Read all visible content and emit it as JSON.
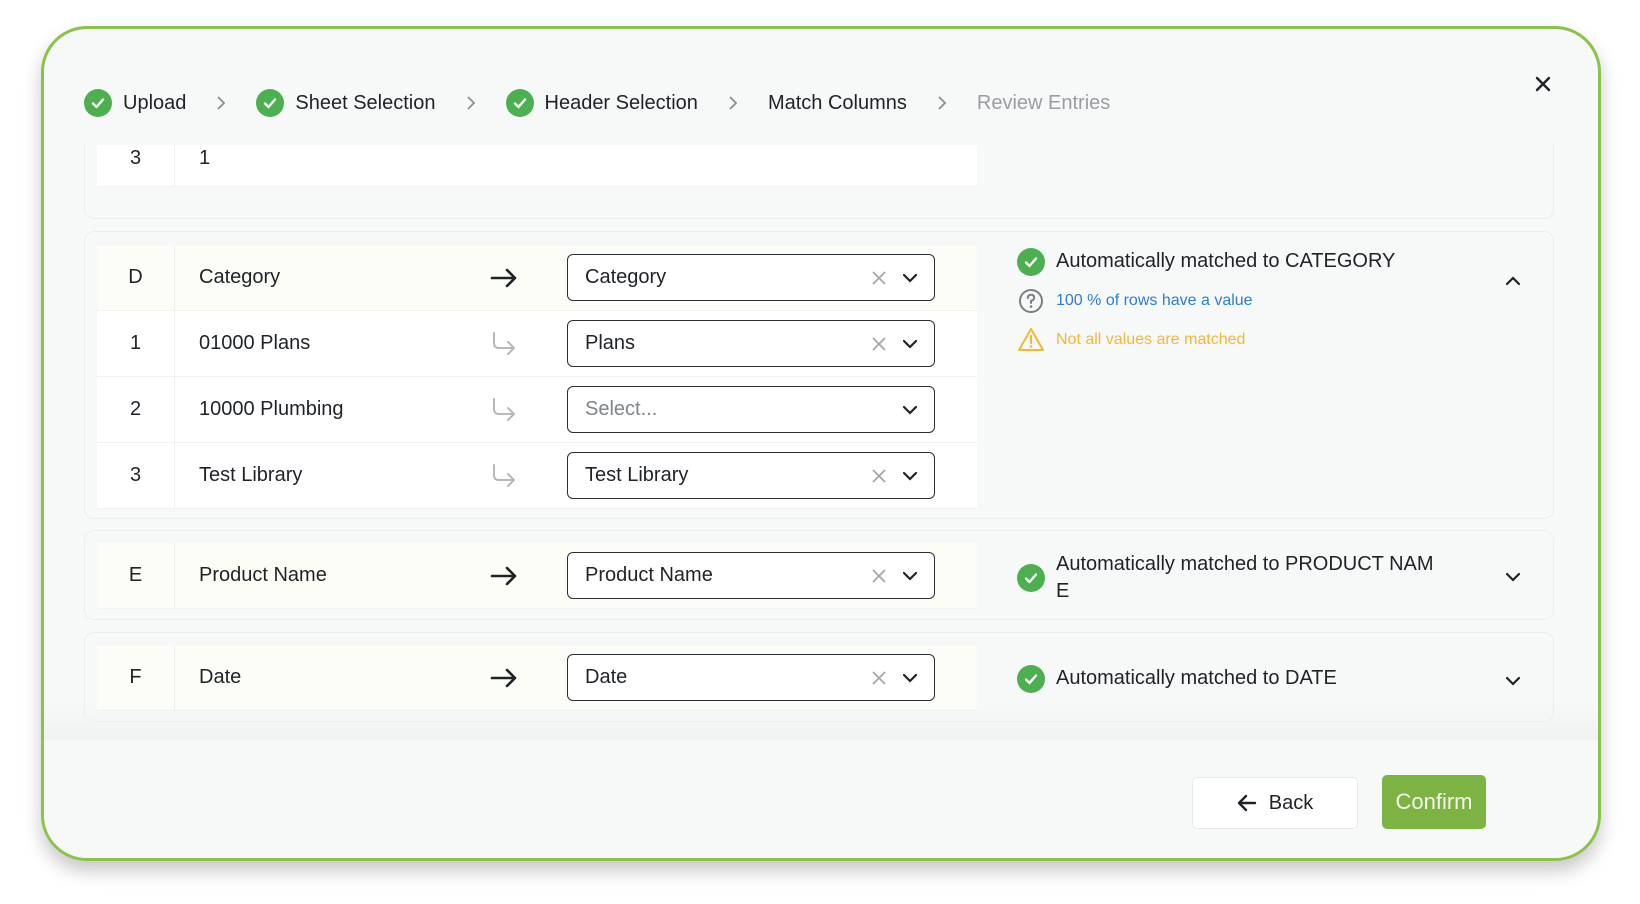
{
  "stepper": {
    "steps": [
      {
        "label": "Upload",
        "state": "done"
      },
      {
        "label": "Sheet Selection",
        "state": "done"
      },
      {
        "label": "Header Selection",
        "state": "done"
      },
      {
        "label": "Match Columns",
        "state": "current"
      },
      {
        "label": "Review Entries",
        "state": "future"
      }
    ],
    "separator_icon": "chevron-right-icon"
  },
  "close_icon": "close-icon",
  "partial_card": {
    "index": "3",
    "value": "1"
  },
  "category_card": {
    "column_letter": "D",
    "column_name": "Category",
    "selected": "Category",
    "values": [
      {
        "index": "1",
        "name": "01000 Plans",
        "selected": "Plans",
        "has_value": true
      },
      {
        "index": "2",
        "name": "10000 Plumbing",
        "selected": "",
        "placeholder": "Select...",
        "has_value": false
      },
      {
        "index": "3",
        "name": "Test Library",
        "selected": "Test Library",
        "has_value": true
      }
    ],
    "status": "Automatically matched to CATEGORY",
    "info": "100 % of rows have a value",
    "warning": "Not all values are matched",
    "expanded": true
  },
  "product_card": {
    "column_letter": "E",
    "column_name": "Product Name",
    "selected": "Product Name",
    "status_line1": "Automatically matched to PRODUCT NAM",
    "status_line2": "E",
    "expanded": false
  },
  "date_card": {
    "column_letter": "F",
    "column_name": "Date",
    "selected": "Date",
    "status": "Automatically matched to DATE",
    "expanded": false
  },
  "footer": {
    "back_label": "Back",
    "confirm_label": "Confirm"
  },
  "colors": {
    "accent": "#7cb342",
    "success": "#4caf50",
    "info": "#2e7cd6",
    "warning": "#f3b835",
    "modal_border": "#8bc34a"
  }
}
